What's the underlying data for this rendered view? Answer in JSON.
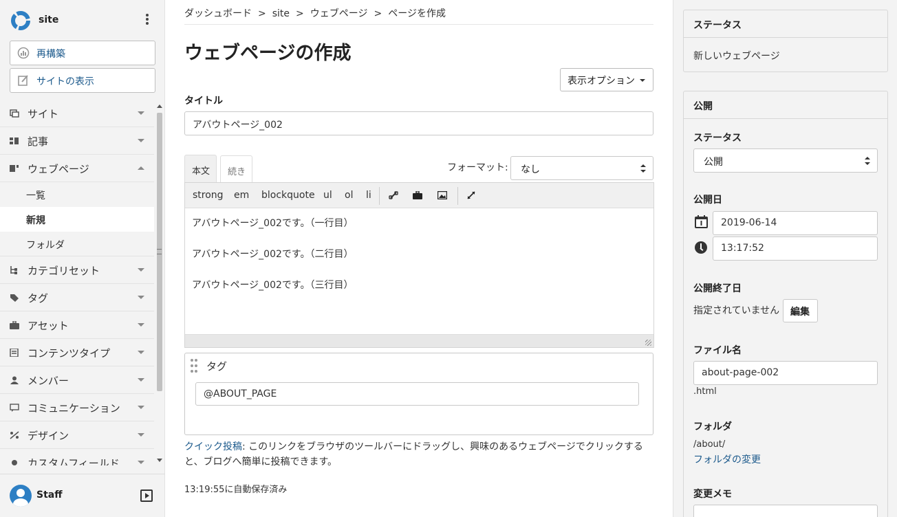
{
  "sidebar": {
    "site_name": "site",
    "rebuild_label": "再構築",
    "view_site_label": "サイトの表示",
    "nav": [
      {
        "label": "サイト"
      },
      {
        "label": "記事"
      },
      {
        "label": "ウェブページ"
      },
      {
        "label": "カテゴリセット"
      },
      {
        "label": "タグ"
      },
      {
        "label": "アセット"
      },
      {
        "label": "コンテンツタイプ"
      },
      {
        "label": "メンバー"
      },
      {
        "label": "コミュニケーション"
      },
      {
        "label": "デザイン"
      },
      {
        "label": "カスタムフィールド"
      }
    ],
    "webpage_sub": [
      "一覧",
      "新規",
      "フォルダ"
    ],
    "user_name": "Staff"
  },
  "breadcrumb": [
    "ダッシュボード",
    "site",
    "ウェブページ",
    "ページを作成"
  ],
  "breadcrumb_sep": ">",
  "page_title": "ウェブページの作成",
  "display_options_label": "表示オプション",
  "title_field": {
    "label": "タイトル",
    "value": "アバウトページ_002"
  },
  "editor": {
    "tabs": [
      "本文",
      "続き"
    ],
    "format_label": "フォーマット:",
    "format_value": "なし",
    "toolbar": [
      "strong",
      "em",
      "blockquote",
      "ul",
      "ol",
      "li"
    ],
    "lines": [
      "アバウトページ_002です。（一行目）",
      "アバウトページ_002です。（二行目）",
      "アバウトページ_002です。（三行目）"
    ]
  },
  "tags": {
    "label": "タグ",
    "value": "@ABOUT_PAGE"
  },
  "quickpost": {
    "link": "クイック投稿",
    "text": ": このリンクをブラウザのツールバーにドラッグし、興味のあるウェブページでクリックすると、ブログへ簡単に投稿できます。"
  },
  "autosave": "13:19:55に自動保存済み",
  "right": {
    "status_panel": {
      "title": "ステータス",
      "value": "新しいウェブページ"
    },
    "publish_panel": {
      "title": "公開",
      "status_label": "ステータス",
      "status_value": "公開",
      "date_label": "公開日",
      "date": "2019-06-14",
      "time": "13:17:52",
      "unpublish_label": "公開終了日",
      "unpublish_text": "指定されていません",
      "edit_label": "編集",
      "filename_label": "ファイル名",
      "filename": "about-page-002",
      "ext": ".html",
      "folder_label": "フォルダ",
      "folder_path": "/about/",
      "folder_change": "フォルダの変更",
      "memo_label": "変更メモ"
    }
  },
  "colors": {
    "link": "#1c5a8c",
    "logo": "#2d7fc4"
  }
}
